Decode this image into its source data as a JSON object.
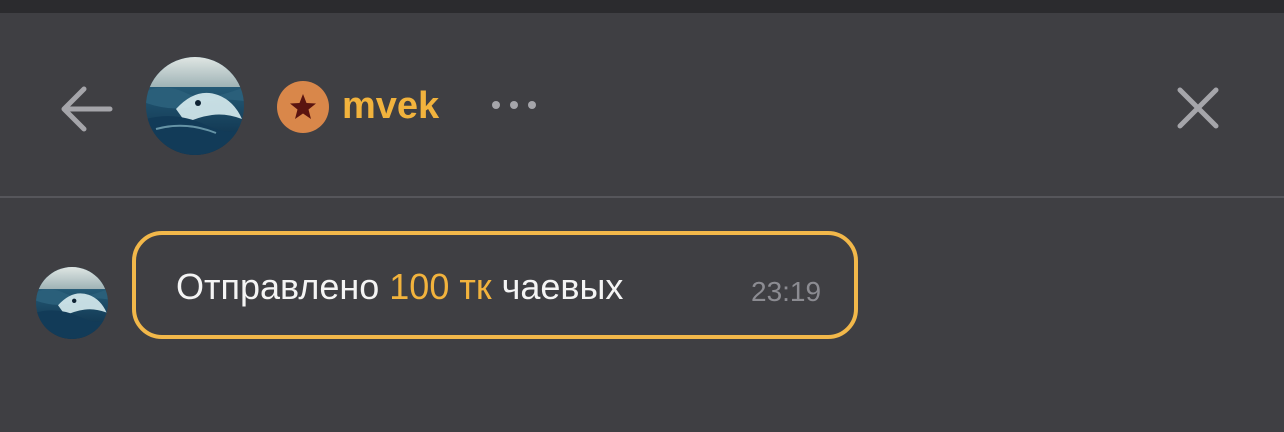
{
  "header": {
    "username": "mvek",
    "back_icon": "arrow-left-icon",
    "more_icon": "more-horizontal-icon",
    "close_icon": "close-icon",
    "badge_icon": "star-icon",
    "badge_color": "#d9874a",
    "username_color": "#f2b33d"
  },
  "message": {
    "prefix": "Отправлено",
    "amount": "100 тк",
    "suffix": "чаевых",
    "time": "23:19",
    "border_color": "#f2b84a"
  },
  "colors": {
    "background": "#3f3f43",
    "topbar": "#2b2b2e",
    "accent": "#f2b33d"
  }
}
